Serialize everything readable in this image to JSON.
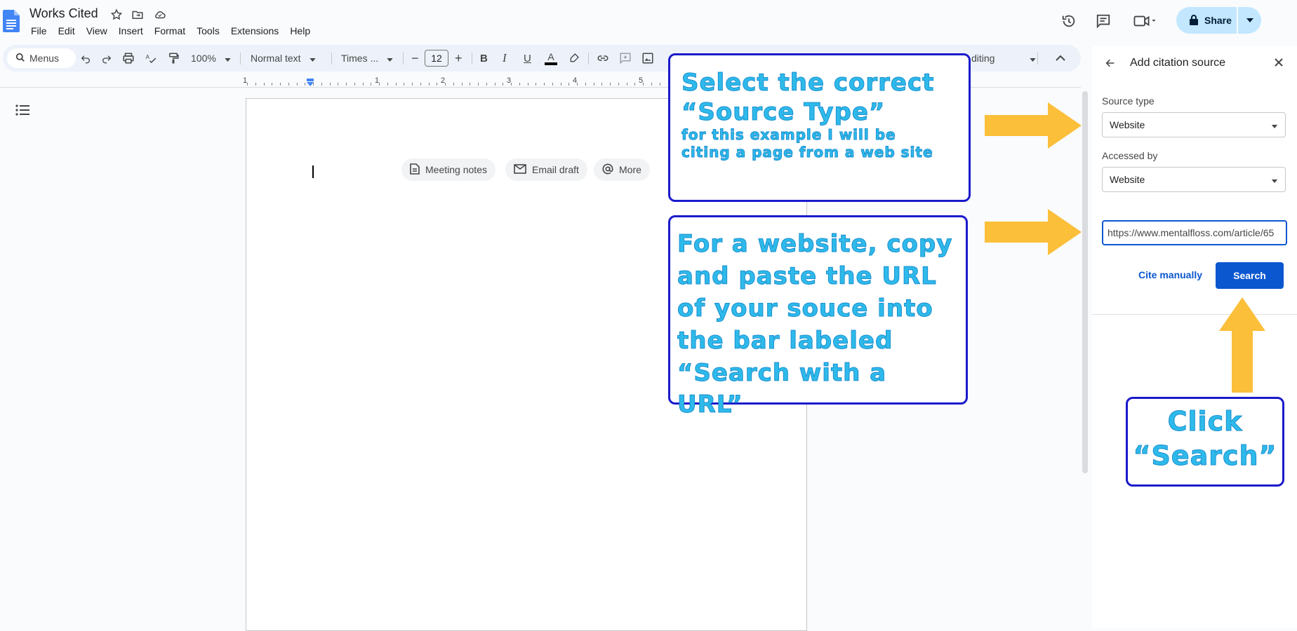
{
  "doc": {
    "title": "Works Cited",
    "menus": [
      "File",
      "Edit",
      "View",
      "Insert",
      "Format",
      "Tools",
      "Extensions",
      "Help"
    ]
  },
  "header": {
    "share_label": "Share"
  },
  "toolbar": {
    "search_menus": "Menus",
    "zoom": "100%",
    "style": "Normal text",
    "font": "Times ...",
    "font_size": "12",
    "mode_label": "diting"
  },
  "ruler": {
    "numbers": [
      "1",
      "1",
      "2",
      "3",
      "4",
      "5"
    ]
  },
  "page": {
    "chips": [
      {
        "label": "Meeting notes",
        "icon": "doc-icon"
      },
      {
        "label": "Email draft",
        "icon": "email-icon"
      },
      {
        "label": "More",
        "icon": "at-icon"
      }
    ]
  },
  "panel": {
    "title": "Add citation source",
    "source_type_label": "Source type",
    "source_type_value": "Website",
    "accessed_by_label": "Accessed by",
    "accessed_by_value": "Website",
    "url_value": "https://www.mentalfloss.com/article/65",
    "cite_manually": "Cite manually",
    "search": "Search"
  },
  "annotations": {
    "note1_line1": "Select the correct",
    "note1_line2": "“Source Type”",
    "note1_line3": "for this example I will be",
    "note1_line4": "citing a page from a web site",
    "note2_line1": "For a website, copy",
    "note2_line2": "and paste the URL",
    "note2_line3": "of your souce into",
    "note2_line4": "the bar labeled",
    "note2_line5": "“Search with a URL”",
    "note3_line1": "Click",
    "note3_line2": "“Search”"
  },
  "colors": {
    "accent": "#0b57d0",
    "arrow": "#fbbf3a",
    "note_text": "#2ebaea",
    "note_border": "#1a1acb"
  }
}
